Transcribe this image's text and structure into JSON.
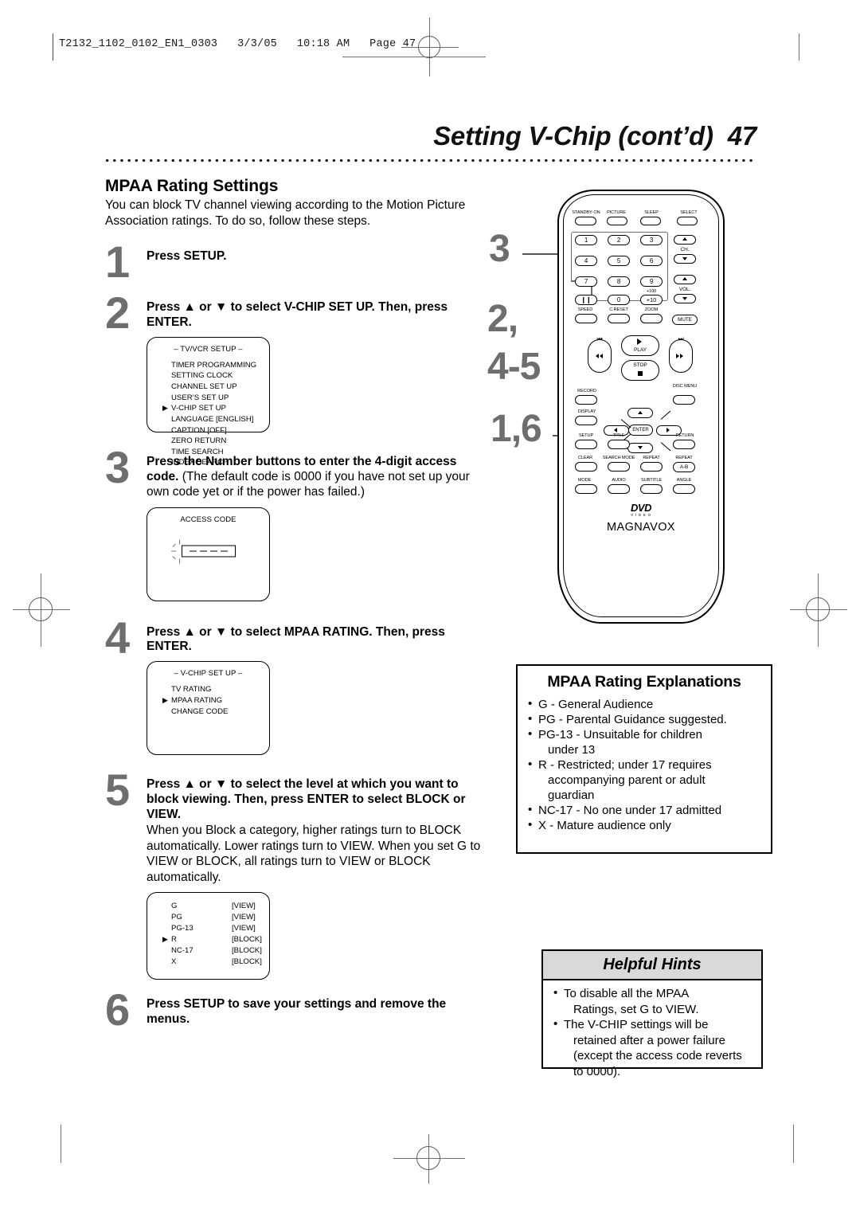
{
  "print_slug": "T2132_1102_0102_EN1_0303   3/3/05   10:18 AM   Page 47",
  "header": {
    "title": "Setting V-Chip (cont’d)",
    "page_number": "47"
  },
  "left": {
    "section_heading": "MPAA Rating Settings",
    "intro": "You can block TV channel viewing according to the Motion Picture Association ratings. To do so, follow these steps.",
    "steps": [
      {
        "num": "1",
        "lead": "Press SETUP."
      },
      {
        "num": "2",
        "lead": "Press ▲ or ▼ to select V-CHIP SET UP. Then, press ENTER."
      },
      {
        "num": "3",
        "lead": "Press the Number buttons to enter the 4-digit access code.",
        "detail": "(The default code is 0000 if you have not set up your own code yet or if the power has failed.)"
      },
      {
        "num": "4",
        "lead": "Press ▲ or ▼ to select MPAA RATING. Then, press ENTER."
      },
      {
        "num": "5",
        "lead": "Press ▲ or ▼ to select the level at which you want to block viewing. Then, press ENTER to select BLOCK or VIEW.",
        "detail": "When you Block a category, higher ratings turn to BLOCK automatically. Lower ratings turn to VIEW. When you set G to VIEW or BLOCK, all ratings turn to VIEW or BLOCK automatically."
      },
      {
        "num": "6",
        "lead": "Press SETUP to save your settings and remove the menus."
      }
    ]
  },
  "osd_setup_menu": {
    "title": "– TV/VCR SETUP –",
    "items": [
      {
        "label": "TIMER PROGRAMMING",
        "selected": false
      },
      {
        "label": "SETTING CLOCK",
        "selected": false
      },
      {
        "label": "CHANNEL SET UP",
        "selected": false
      },
      {
        "label": "USER’S SET UP",
        "selected": false
      },
      {
        "label": "V-CHIP SET UP",
        "selected": true
      },
      {
        "label": "LANGUAGE  [ENGLISH]",
        "selected": false
      },
      {
        "label": "CAPTION  [OFF]",
        "selected": false
      },
      {
        "label": "ZERO RETURN",
        "selected": false
      },
      {
        "label": "TIME SEARCH",
        "selected": false
      },
      {
        "label": "INDEX SEARCH",
        "selected": false
      }
    ]
  },
  "osd_access_code": {
    "title": "ACCESS CODE",
    "digits": [
      "–",
      "–",
      "–",
      "–"
    ]
  },
  "osd_vchip_menu": {
    "title": "– V-CHIP SET UP –",
    "items": [
      {
        "label": "TV RATING",
        "selected": false
      },
      {
        "label": "MPAA RATING",
        "selected": true
      },
      {
        "label": "CHANGE CODE",
        "selected": false
      }
    ]
  },
  "osd_mpaa_levels": {
    "rows": [
      {
        "rating": "G",
        "state": "[VIEW]",
        "selected": false
      },
      {
        "rating": "PG",
        "state": "[VIEW]",
        "selected": false
      },
      {
        "rating": "PG-13",
        "state": "[VIEW]",
        "selected": false
      },
      {
        "rating": "R",
        "state": "[BLOCK]",
        "selected": true
      },
      {
        "rating": "NC-17",
        "state": "[BLOCK]",
        "selected": false
      },
      {
        "rating": "X",
        "state": "[BLOCK]",
        "selected": false
      }
    ]
  },
  "explanations": {
    "title": "MPAA Rating Explanations",
    "items": [
      {
        "text": "G - General Audience",
        "cont": false
      },
      {
        "text": "PG - Parental Guidance suggested.",
        "cont": false
      },
      {
        "text": "PG-13 - Unsuitable for children",
        "cont": false
      },
      {
        "text": "under 13",
        "cont": true
      },
      {
        "text": "R - Restricted; under 17 requires",
        "cont": false
      },
      {
        "text": "accompanying parent or adult",
        "cont": true
      },
      {
        "text": "guardian",
        "cont": true
      },
      {
        "text": "NC-17 - No one under 17 admitted",
        "cont": false
      },
      {
        "text": "X - Mature audience only",
        "cont": false
      }
    ]
  },
  "hints": {
    "title": "Helpful Hints",
    "items": [
      {
        "text": "To disable all the MPAA",
        "cont": false
      },
      {
        "text": "Ratings, set G to VIEW.",
        "cont": true
      },
      {
        "text": "The V-CHIP settings will be",
        "cont": false
      },
      {
        "text": "retained after a power failure",
        "cont": true
      },
      {
        "text": "(except the access code reverts",
        "cont": true
      },
      {
        "text": "to 0000).",
        "cont": true
      }
    ]
  },
  "callouts": [
    {
      "label": "3",
      "target": "number-buttons"
    },
    {
      "label": "2,",
      "target": "cursor-buttons"
    },
    {
      "label": "4-5",
      "target": "cursor-buttons"
    },
    {
      "label": "1,6",
      "target": "setup-button"
    }
  ],
  "remote": {
    "brand": "MAGNAVOX",
    "logo": "DVD",
    "logo_sub": "V I D E O",
    "top_row": [
      "STANDBY·ON",
      "PICTURE",
      "SLEEP",
      "SELECT"
    ],
    "keypad": [
      "1",
      "2",
      "3",
      "4",
      "5",
      "6",
      "7",
      "8",
      "9",
      "❙❙",
      "0",
      "+10"
    ],
    "keypad_plus100": "+100",
    "ch_label": "CH.",
    "vol_label": "VOL.",
    "row_speed": [
      "SPEED",
      "C.RESET",
      "ZOOM"
    ],
    "mute": "MUTE",
    "play": "PLAY",
    "stop": "STOP",
    "row_record": [
      "RECORD",
      "DISC MENU"
    ],
    "row_display": [
      "DISPLAY"
    ],
    "enter": "ENTER",
    "row_setup": [
      "SETUP",
      "TITLE",
      "RETURN"
    ],
    "row_clear": [
      "CLEAR",
      "SEARCH MODE",
      "REPEAT",
      "REPEAT"
    ],
    "repeat_ab": "A-B",
    "row_mode": [
      "MODE",
      "AUDIO",
      "SUBTITLE",
      "ANGLE"
    ]
  }
}
